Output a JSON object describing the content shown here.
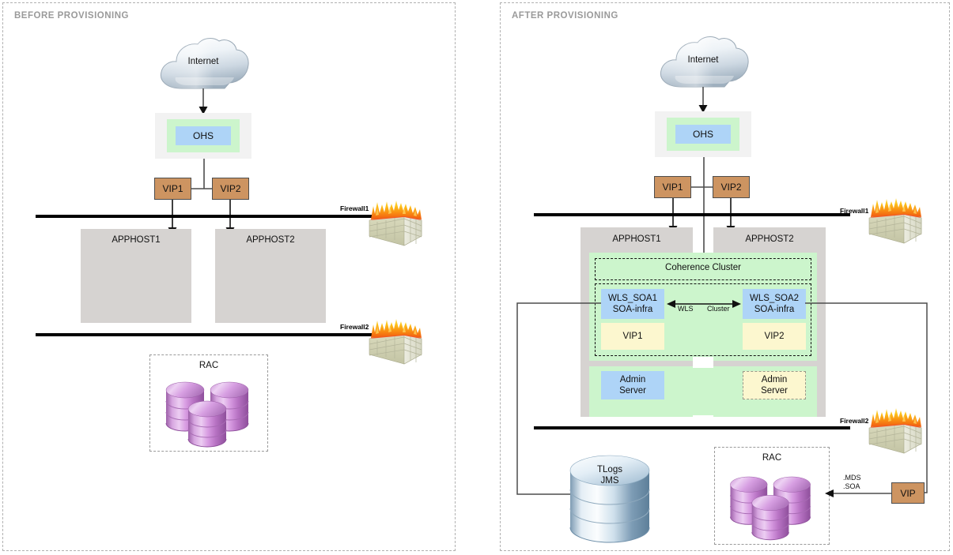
{
  "panels": {
    "before": {
      "title": "BEFORE PROVISIONING"
    },
    "after": {
      "title": "AFTER PROVISIONING"
    }
  },
  "before": {
    "internet": "Internet",
    "ohs": "OHS",
    "vip1": "VIP1",
    "vip2": "VIP2",
    "apphost1": "APPHOST1",
    "apphost2": "APPHOST2",
    "firewall1": "Firewall1",
    "firewall2": "Firewall2",
    "rac": "RAC"
  },
  "after": {
    "internet": "Internet",
    "ohs": "OHS",
    "vip1": "VIP1",
    "vip2": "VIP2",
    "apphost1": "APPHOST1",
    "apphost2": "APPHOST2",
    "coherence_cluster": "Coherence Cluster",
    "wls_soa1_line1": "WLS_SOA1",
    "wls_soa1_line2": "SOA-infra",
    "wls_soa2_line1": "WLS_SOA2",
    "wls_soa2_line2": "SOA-infra",
    "cluster_label_left": "WLS",
    "cluster_label_right": "Cluster",
    "host_vip1": "VIP1",
    "host_vip2": "VIP2",
    "admin_server1_line1": "Admin",
    "admin_server1_line2": "Server",
    "admin_server2_line1": "Admin",
    "admin_server2_line2": "Server",
    "firewall1": "Firewall1",
    "firewall2": "Firewall2",
    "tlogs_line1": "TLogs",
    "tlogs_line2": "JMS",
    "rac": "RAC",
    "mds_label_line1": ".MDS",
    "mds_label_line2": ".SOA",
    "vip_db": "VIP"
  },
  "icons": {
    "cloud": "cloud-icon",
    "firewall": "firewall-brick-flame-icon",
    "database_rac": "database-cluster-icon",
    "database_tlogs": "database-cylinder-icon",
    "arrow": "arrow-icon"
  },
  "colors": {
    "panel_border": "#b0b0b0",
    "title_text": "#9a9a9a",
    "host_gray": "#d6d3d1",
    "green": "#ccf5cc",
    "blue": "#aed4f7",
    "yellow": "#fcf7cf",
    "vip_tan": "#cd9461",
    "firewall_line": "#000000",
    "connector": "#4d4d4d",
    "db_purple": "#d9a0e0",
    "db_blue": "#b8cfe0"
  }
}
